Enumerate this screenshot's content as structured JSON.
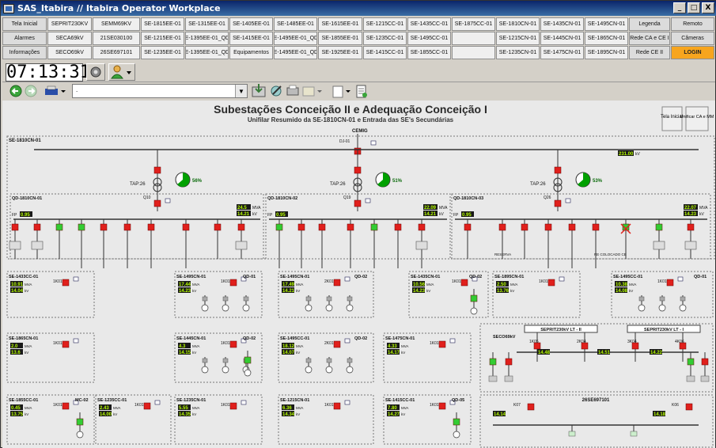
{
  "window": {
    "title": "SAS_Itabira // Itabira Operator Workplace",
    "btn_min": "_",
    "btn_max": "□",
    "btn_close": "X"
  },
  "nav": [
    [
      "Tela Inicial",
      "SEPRIT230KV",
      "SEMM69KV",
      "SE-1815EE-01",
      "SE-1315EE-01",
      "SE-1405EE-01",
      "SE-1485EE-01",
      "SE-1615EE-01",
      "SE-1215CC-01",
      "SE-1435CC-01",
      "SE-1875CC-01",
      "SE-1810CN-01",
      "SE-1435CN-01",
      "SE-1495CN-01",
      "Legenda",
      "Remoto"
    ],
    [
      "Alarmes",
      "SECA69kV",
      "21SE030100",
      "SE-1215EE-01",
      "SE-1395EE-01_QD1",
      "SE-1415EE-01",
      "SE-1495EE-01_QD1",
      "SE-1855EE-01",
      "SE-1235CC-01",
      "SE-1495CC-01",
      "",
      "SE-1215CN-01",
      "SE-1445CN-01",
      "SE-1865CN-01",
      "Rede CA e CE I",
      "Câmeras"
    ],
    [
      "Informações",
      "SECO69kV",
      "26SE697101",
      "SE-1235EE-01",
      "SE-1395EE-01_QD2",
      "Equipamentos",
      "SE-1495EE-01_QD2",
      "SE-1925EE-01",
      "SE-1415CC-01",
      "SE-1855CC-01",
      "",
      "SE-1235CN-01",
      "SE-1475CN-01",
      "SE-1895CN-01",
      "Rede CE II",
      "LOGIN"
    ]
  ],
  "clock": "07:13:31",
  "address": ".",
  "diagram": {
    "title": "Subestações Conceição II e Adequação Conceição I",
    "subtitle": "Unifilar Resumido da SE-1810CN-01 e Entrada das SE's Secundárias",
    "btn_home": "Tela Inicial",
    "btn_unify": "Unificar CA e MM",
    "sub_main": "SE-1810CN-01",
    "cemig": "CEMIG",
    "dj": "DJ-01",
    "kv_main": "231.00",
    "kv_unit": "kV",
    "tap1": "TAP:26",
    "tap2": "TAP:26",
    "tap3": "TAP:26",
    "pct1": "56%",
    "pct2": "51%",
    "pct3": "53%",
    "qd1": "QD-1810CN-01",
    "qd2": "QD-1810CN-02",
    "qd3": "QD-1810CN-03",
    "q10": "Q10",
    "q19": "Q19",
    "q26": "Q26",
    "fp": "FP",
    "fp1": "0.95",
    "fp2": "0.95",
    "fp3": "0.95",
    "mva1": "24.5",
    "kv1": "14.21",
    "mva2": "22.09",
    "kv2": "14.21",
    "mva3": "22.07",
    "kv3": "14.23",
    "mva_unit": "MVA",
    "reserva": "RESERVA",
    "res_colocado": "RE COLOCADO CE",
    "subs": [
      {
        "name": "SE-1433CC-01",
        "mva": "10.91",
        "kv": "14.04",
        "k": "1K01"
      },
      {
        "name": "SE-1495CN-01",
        "mva": "17.44",
        "kv": "14.23",
        "k": "1K01",
        "qd": "QD-01"
      },
      {
        "name": "SE-1495CN-01",
        "mva": "17.49",
        "kv": "14.21",
        "k": "2K01",
        "qd": "QD-02"
      },
      {
        "name": "SE-1435CN-01",
        "mva": "10.56",
        "kv": "14.23",
        "k": "1K01",
        "qd": "QD-02"
      },
      {
        "name": "SE-1895CN-01",
        "mva": "2.50",
        "kv": "13.76",
        "k": "1K01"
      },
      {
        "name": "SE-1495CC-01",
        "mva": "10.38",
        "kv": "14.08",
        "k": "1K01",
        "qd": "QD-01"
      },
      {
        "name": "SE-1865CN-01",
        "mva": "2.0",
        "kv": "13.6",
        "k": "1K01"
      },
      {
        "name": "SE-1445CN-01",
        "mva": "4.3",
        "kv": "14.15",
        "k": "1K01",
        "qd": "QD-02"
      },
      {
        "name": "SE-1495CC-01",
        "mva": "18.12",
        "kv": "14.07",
        "k": "2K01",
        "qd": "QD-02"
      },
      {
        "name": "SE-1475CN-01",
        "mva": "4.33",
        "kv": "14.17",
        "k": "1K01"
      },
      {
        "name": "SE-1855CC-01",
        "mva": "0.45",
        "kv": "13.75",
        "k": "1K01",
        "qd": "MC-02"
      },
      {
        "name": "SE-1235CC-01",
        "mva": "2.43",
        "kv": "14.00",
        "k": "1K01"
      },
      {
        "name": "SE-1235CN-01",
        "mva": "5.55",
        "kv": "14.35",
        "k": "1K01"
      },
      {
        "name": "SE-1215CN-01",
        "mva": "6.36",
        "kv": "14.34",
        "k": "1K01"
      },
      {
        "name": "SE-1415CC-01",
        "mva": "7.80",
        "kv": "14.27",
        "k": "1K01",
        "qd": "QD-05"
      }
    ],
    "seprit1": "SEPRIT230kV  LT - II",
    "seprit2": "SEPRIT230kV  LT - I",
    "seco": "SECO69kV",
    "k1k05": "1K05",
    "k2k04": "2K04",
    "k3k04": "3K04",
    "k4k06": "4K06",
    "seco_kv1": "14.48",
    "seco_kv2": "14.51",
    "seco_kv3": "14.22",
    "bottom_sub": "26SE697101",
    "k07": "K07",
    "k06": "K06",
    "b_kv1": "14.14",
    "b_kv2": "14.18"
  },
  "colors": {
    "breaker": "#e0201c",
    "closed_green": "#00a000",
    "meter_bg": "#1a1a1a",
    "meter_fg": "#b8ff00",
    "login": "#f7a51e"
  }
}
